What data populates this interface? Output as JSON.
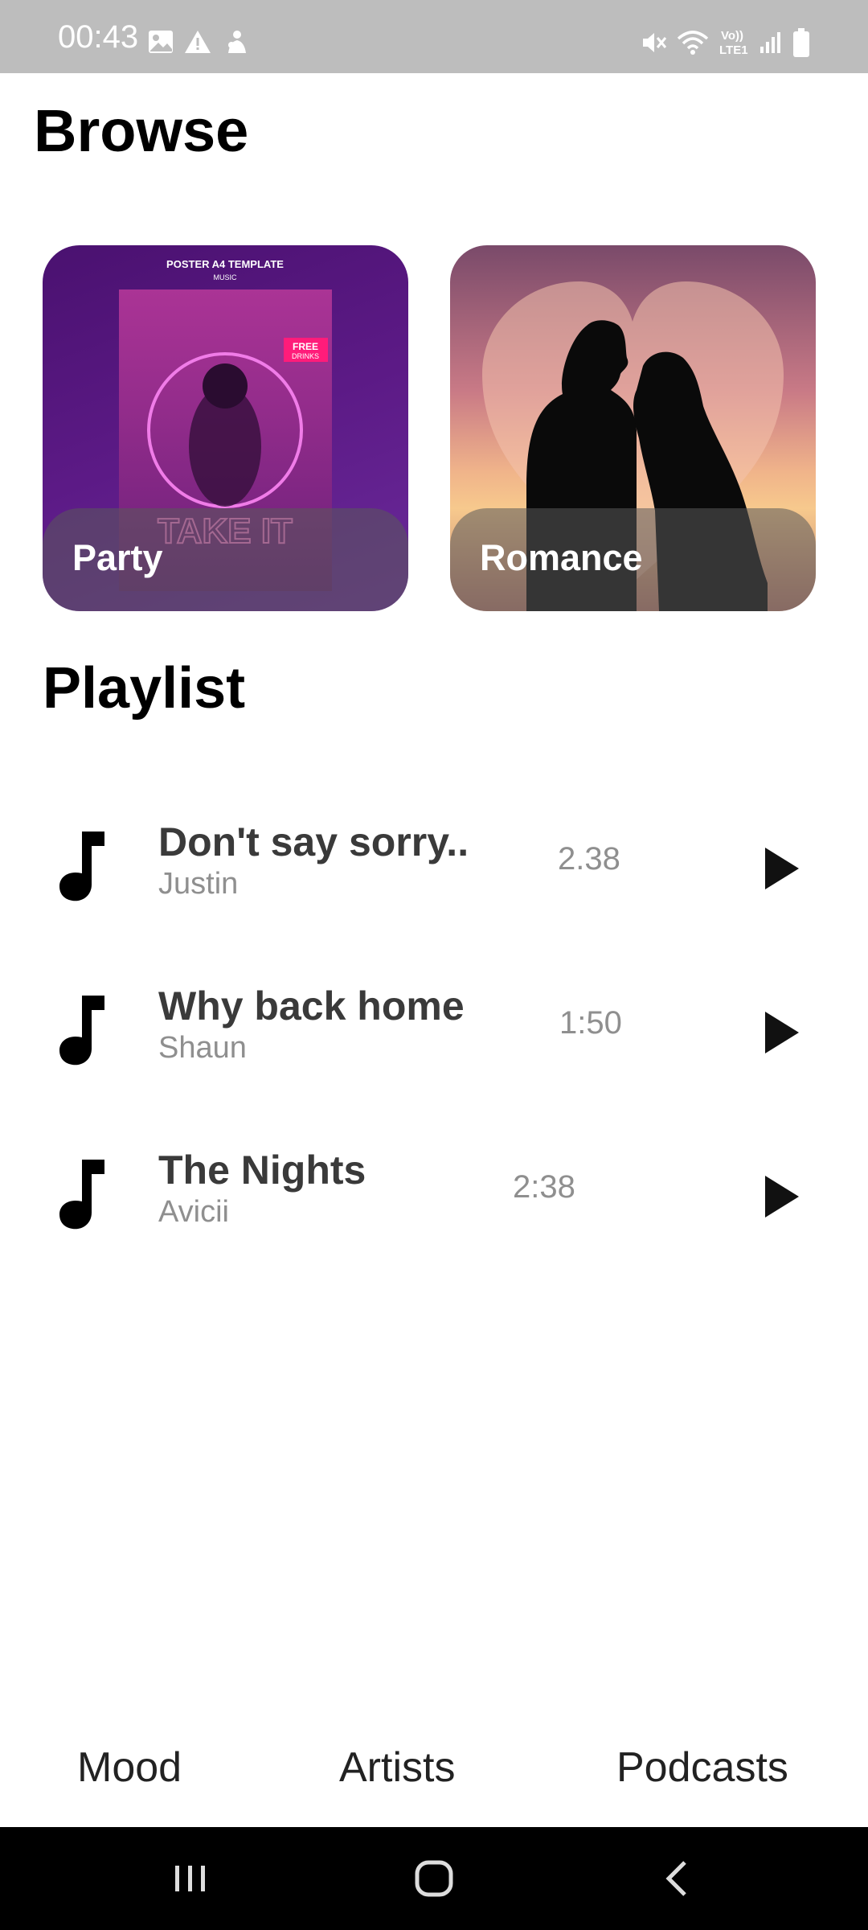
{
  "status_bar": {
    "time": "00:43",
    "left_icons": [
      "image-icon",
      "warning-icon",
      "notification-icon"
    ],
    "right_icons": [
      "mute-icon",
      "wifi-icon",
      "volte-icon",
      "signal-icon",
      "battery-icon"
    ]
  },
  "browse": {
    "title": "Browse",
    "cards": [
      {
        "label": "Party"
      },
      {
        "label": "Romance"
      }
    ]
  },
  "playlist": {
    "title": "Playlist",
    "tracks": [
      {
        "title": "Don't say sorry..",
        "artist": "Justin",
        "duration": "2.38"
      },
      {
        "title": "Why back home",
        "artist": "Shaun",
        "duration": "1:50"
      },
      {
        "title": "The Nights",
        "artist": "Avicii",
        "duration": "2:38"
      }
    ]
  },
  "tabs": [
    "Mood",
    "Artists",
    "Podcasts"
  ],
  "colors": {
    "status_bar": "#bdbdbd",
    "title_text": "#000000",
    "track_title": "#3a3a3a",
    "secondary_text": "#8f8f8f",
    "nav_bar": "#000000"
  }
}
